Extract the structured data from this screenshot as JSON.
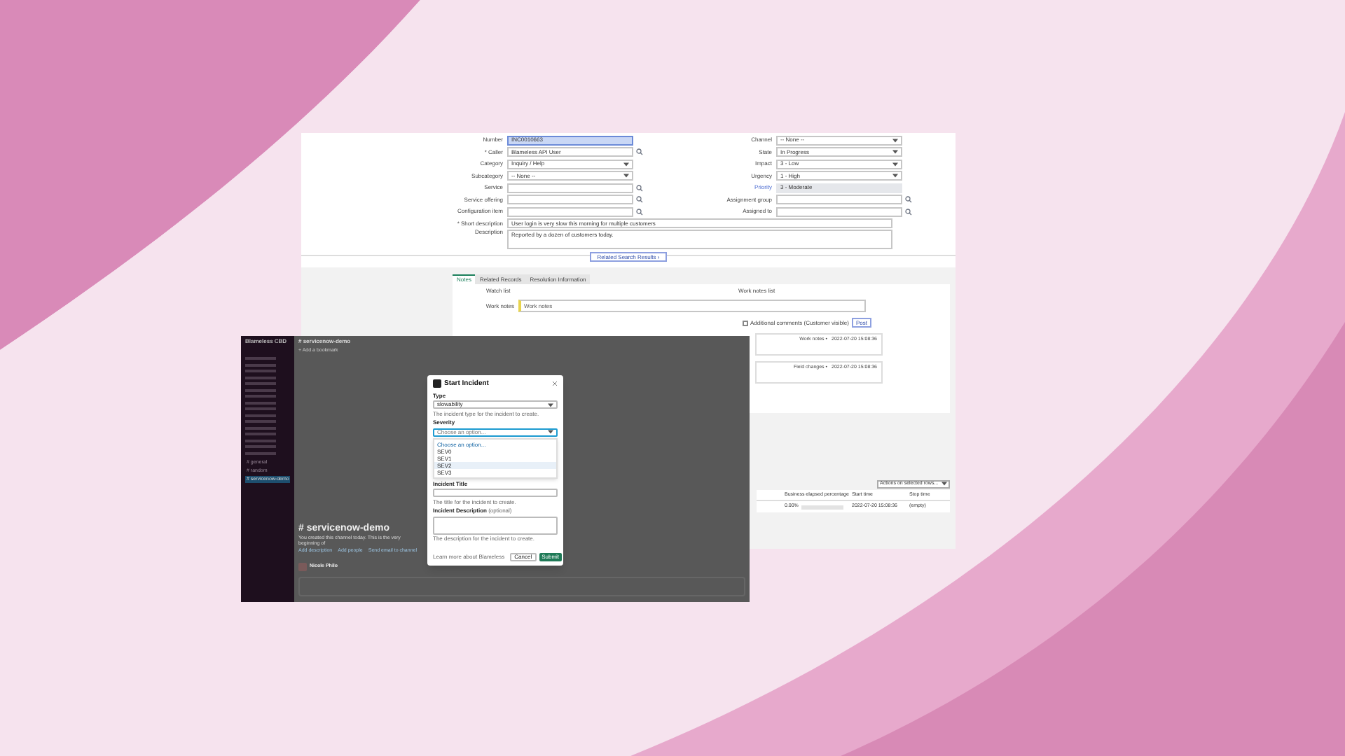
{
  "servicenow": {
    "left_fields": [
      {
        "label": "Number",
        "value": "INC0010663",
        "kind": "text",
        "highlighted": true
      },
      {
        "label": "* Caller",
        "value": "Blameless API User",
        "kind": "lookup",
        "highlighted": false
      },
      {
        "label": "Category",
        "value": "Inquiry / Help",
        "kind": "select",
        "highlighted": false
      },
      {
        "label": "Subcategory",
        "value": "-- None --",
        "kind": "select",
        "highlighted": false
      },
      {
        "label": "Service",
        "kind": "lookup",
        "highlighted": false
      },
      {
        "label": "Service offering",
        "kind": "lookup",
        "highlighted": false
      },
      {
        "label": "Configuration item",
        "kind": "lookup",
        "highlighted": false
      }
    ],
    "right_fields": [
      {
        "label": "Channel",
        "value": "-- None --",
        "kind": "select",
        "link": false
      },
      {
        "label": "State",
        "value": "In Progress",
        "kind": "select",
        "link": false
      },
      {
        "label": "Impact",
        "value": "3 - Low",
        "kind": "select",
        "link": false
      },
      {
        "label": "Urgency",
        "value": "1 - High",
        "kind": "select",
        "link": false
      },
      {
        "label": "Priority",
        "value": "3 - Moderate",
        "kind": "readonly",
        "link": true
      },
      {
        "label": "Assignment group",
        "kind": "lookup",
        "link": false
      },
      {
        "label": "Assigned to",
        "kind": "lookup",
        "link": false
      }
    ],
    "short_description": {
      "label": "* Short description",
      "value": "User login is very slow this morning for multiple customers"
    },
    "description": {
      "label": "Description",
      "value": "Reported by a dozen of customers today."
    },
    "related_button": "Related Search Results ›",
    "tabs": [
      {
        "label": "Notes",
        "selected": true
      },
      {
        "label": "Related Records",
        "selected": false
      },
      {
        "label": "Resolution Information",
        "selected": false
      }
    ],
    "watch_list": "Watch list",
    "work_notes_list": "Work notes list",
    "work_notes": {
      "label": "Work notes",
      "placeholder": "Work notes"
    },
    "additional_comments": {
      "label": "Additional comments (Customer visible)",
      "checked": false
    },
    "post_button": "Post",
    "activity": [
      {
        "type": "Work notes •",
        "time": "2022-07-20 15:08:36"
      },
      {
        "type": "Field changes •",
        "time": "2022-07-20 15:08:36"
      }
    ],
    "actions_select": "Actions on selected rows...",
    "table": {
      "columns": [
        "Business elapsed percentage",
        "Start time",
        "Stop time"
      ],
      "rows": [
        {
          "cells": [
            "0.00%",
            "2022-07-20 15:08:36",
            "(empty)"
          ]
        }
      ]
    }
  },
  "slack": {
    "workspace": "Blameless CBD",
    "channels": [
      {
        "label": "# general",
        "selected": false
      },
      {
        "label": "# random",
        "selected": false
      },
      {
        "label": "# servicenow-demo",
        "selected": true
      }
    ],
    "header": "# servicenow-demo",
    "bookmark": "+ Add a bookmark",
    "intro_title": "# servicenow-demo",
    "intro_text": "You created this channel today. This is the very beginning of",
    "intro_links": [
      "Add description",
      "Add people",
      "Send email to channel"
    ],
    "message_author": "Nicole Philo",
    "modal": {
      "title": "Start Incident",
      "type": {
        "label": "Type",
        "value": "slowability",
        "hint": "The incident type for the incident to create."
      },
      "severity": {
        "label": "Severity",
        "placeholder": "Choose an option...",
        "options": [
          {
            "label": "Choose an option...",
            "selected": true,
            "hovered": false
          },
          {
            "label": "SEV0",
            "selected": false,
            "hovered": false
          },
          {
            "label": "SEV1",
            "selected": false,
            "hovered": false
          },
          {
            "label": "SEV2",
            "selected": false,
            "hovered": true
          },
          {
            "label": "SEV3",
            "selected": false,
            "hovered": false
          }
        ]
      },
      "title_field": {
        "label": "Incident Title",
        "hint": "The title for the incident to create."
      },
      "description_field": {
        "label": "Incident Description",
        "optional": "(optional)",
        "hint": "The description for the incident to create."
      },
      "learn_more": "Learn more about Blameless",
      "cancel": "Cancel",
      "submit": "Submit"
    }
  }
}
